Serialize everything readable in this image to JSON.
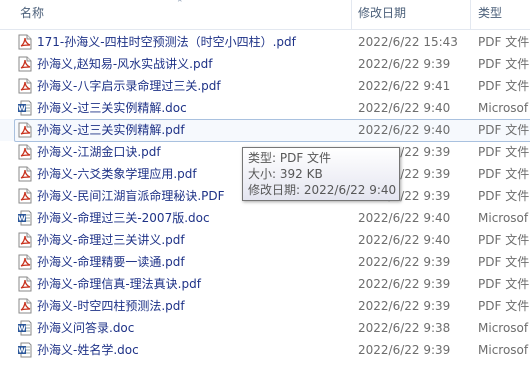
{
  "header": {
    "name_col": "名称",
    "date_col": "修改日期",
    "type_col": "类型"
  },
  "files": [
    {
      "name": "171-孙海义-四柱时空预测法（时空小四柱）.pdf",
      "date": "2022/6/22 15:43",
      "type": "PDF 文件",
      "icon": "pdf-file-icon"
    },
    {
      "name": "孙海义,赵知易-风水实战讲义.pdf",
      "date": "2022/6/22 9:39",
      "type": "PDF 文件",
      "icon": "pdf-file-icon"
    },
    {
      "name": "孙海义-八字启示录命理过三关.pdf",
      "date": "2022/6/22 9:41",
      "type": "PDF 文件",
      "icon": "pdf-file-icon"
    },
    {
      "name": "孙海义-过三关实例精解.doc",
      "date": "2022/6/22 9:40",
      "type": "Microsof",
      "icon": "word-file-icon"
    },
    {
      "name": "孙海义-过三关实例精解.pdf",
      "date": "2022/6/22 9:40",
      "type": "PDF 文件",
      "icon": "pdf-file-icon",
      "selected": true
    },
    {
      "name": "孙海义-江湖金口诀.pdf",
      "date": "2022/6/22 9:39",
      "type": "PDF 文件",
      "icon": "pdf-file-icon"
    },
    {
      "name": "孙海义-六爻类象学理应用.pdf",
      "date": "2022/6/22 9:39",
      "type": "PDF 文件",
      "icon": "pdf-file-icon"
    },
    {
      "name": "孙海义-民间江湖盲派命理秘诀.PDF",
      "date": "2022/6/22 9:39",
      "type": "PDF 文件",
      "icon": "pdf-file-icon"
    },
    {
      "name": "孙海义-命理过三关-2007版.doc",
      "date": "2022/6/22 9:40",
      "type": "Microsof",
      "icon": "word-file-icon"
    },
    {
      "name": "孙海义-命理过三关讲义.pdf",
      "date": "2022/6/22 9:40",
      "type": "PDF 文件",
      "icon": "pdf-file-icon"
    },
    {
      "name": "孙海义-命理精要一读通.pdf",
      "date": "2022/6/22 9:39",
      "type": "PDF 文件",
      "icon": "pdf-file-icon"
    },
    {
      "name": "孙海义-命理信真-理法真诀.pdf",
      "date": "2022/6/22 9:39",
      "type": "PDF 文件",
      "icon": "pdf-file-icon"
    },
    {
      "name": "孙海义-时空四柱预测法.pdf",
      "date": "2022/6/22 9:39",
      "type": "PDF 文件",
      "icon": "pdf-file-icon"
    },
    {
      "name": "孙海义问答录.doc",
      "date": "2022/6/22 9:38",
      "type": "Microsof",
      "icon": "word-file-icon"
    },
    {
      "name": "孙海义-姓名学.doc",
      "date": "2022/6/22 9:39",
      "type": "Microsof",
      "icon": "word-file-icon"
    }
  ],
  "tooltip": {
    "type_line": "类型: PDF 文件",
    "size_line": "大小: 392 KB",
    "date_line": "修改日期: 2022/6/22 9:40"
  },
  "colors": {
    "pdf_icon": "#c8321e",
    "word_icon": "#2b579a",
    "selection_border": "#a9c1df"
  }
}
